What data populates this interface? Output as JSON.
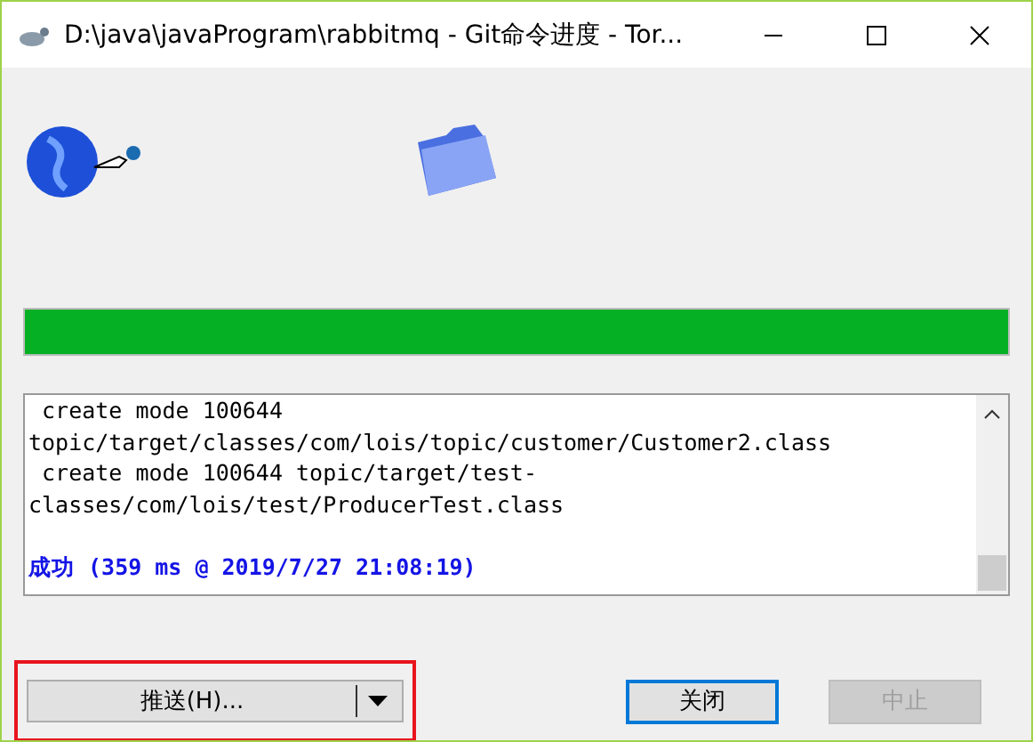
{
  "window": {
    "title": "D:\\java\\javaProgram\\rabbitmq - Git命令进度 - Tor..."
  },
  "progress": {
    "level": 1
  },
  "log": {
    "lines": [
      {
        "kind": "normal",
        "text": " create mode 100644"
      },
      {
        "kind": "normal",
        "text": "topic/target/classes/com/lois/topic/customer/Customer2.class"
      },
      {
        "kind": "normal",
        "text": " create mode 100644 topic/target/test-"
      },
      {
        "kind": "normal",
        "text": "classes/com/lois/test/ProducerTest.class"
      },
      {
        "kind": "blank"
      },
      {
        "kind": "success",
        "text": "成功 (359 ms @ 2019/7/27 21:08:19)"
      }
    ]
  },
  "buttons": [
    {
      "kind": "split",
      "label": "推送(H)...",
      "disabled": false,
      "highlighted": true
    },
    {
      "kind": "default",
      "label": "关闭",
      "disabled": false
    },
    {
      "kind": "plain",
      "label": "中止",
      "disabled": true
    }
  ]
}
